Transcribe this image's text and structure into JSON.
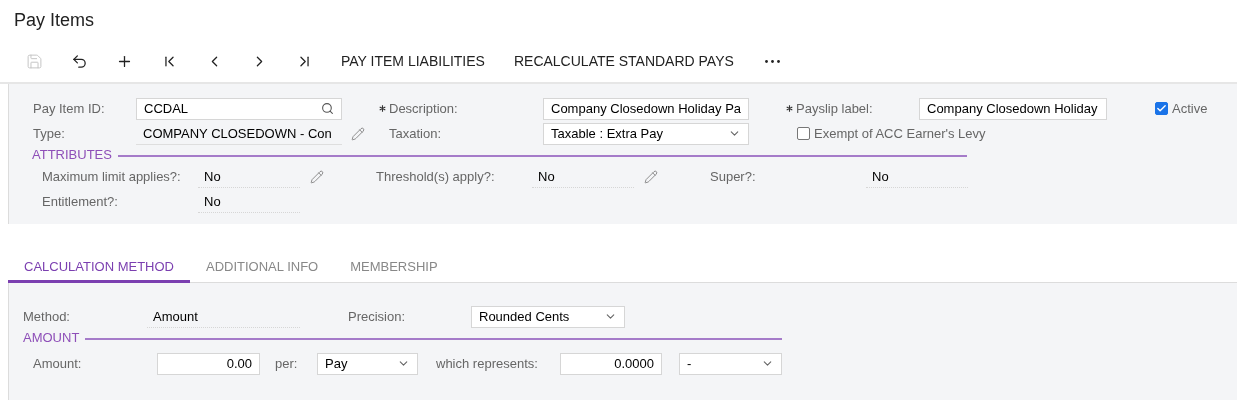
{
  "page_title": "Pay Items",
  "toolbar": {
    "icons": [
      {
        "kind": "save",
        "disabled": true
      },
      {
        "kind": "undo",
        "disabled": false
      },
      {
        "kind": "add",
        "disabled": false
      },
      {
        "kind": "first",
        "disabled": false
      },
      {
        "kind": "previous",
        "disabled": false
      },
      {
        "kind": "next",
        "disabled": false
      },
      {
        "kind": "last",
        "disabled": false
      }
    ],
    "buttons": [
      "PAY ITEM LIABILITIES",
      "RECALCULATE STANDARD PAYS"
    ]
  },
  "header": {
    "pay_item_id": {
      "label": "Pay Item ID:",
      "value": "CCDAL"
    },
    "description": {
      "label": "Description:",
      "required": true,
      "value": "Company Closedown Holiday Pa"
    },
    "payslip_label": {
      "label": "Payslip label:",
      "required": true,
      "value": "Company Closedown Holiday"
    },
    "active": {
      "label": "Active",
      "checked": true
    },
    "type": {
      "label": "Type:",
      "value": "COMPANY CLOSEDOWN - Con"
    },
    "taxation": {
      "label": "Taxation:",
      "value": "Taxable : Extra Pay"
    },
    "exempt": {
      "label": "Exempt of ACC Earner's Levy",
      "checked": false
    }
  },
  "attributes": {
    "title": "ATTRIBUTES",
    "items": [
      {
        "label": "Maximum limit applies?:",
        "value": "No",
        "editable": true
      },
      {
        "label": "Threshold(s) apply?:",
        "value": "No",
        "editable": true
      },
      {
        "label": "Super?:",
        "value": "No",
        "editable": false
      },
      {
        "label": "Entitlement?:",
        "value": "No",
        "editable": false
      }
    ]
  },
  "tabs": [
    {
      "label": "CALCULATION METHOD",
      "selected": true
    },
    {
      "label": "ADDITIONAL INFO",
      "selected": false
    },
    {
      "label": "MEMBERSHIP",
      "selected": false
    }
  ],
  "calculation": {
    "method": {
      "label": "Method:",
      "value": "Amount"
    },
    "precision": {
      "label": "Precision:",
      "value": "Rounded Cents"
    },
    "amount_section": {
      "title": "AMOUNT",
      "amount": {
        "label": "Amount:",
        "value": "0.00"
      },
      "per": {
        "label": "per:",
        "value": "Pay"
      },
      "represents": {
        "label": "which represents:",
        "value": "0.0000"
      },
      "unit": {
        "value": "-"
      }
    }
  }
}
